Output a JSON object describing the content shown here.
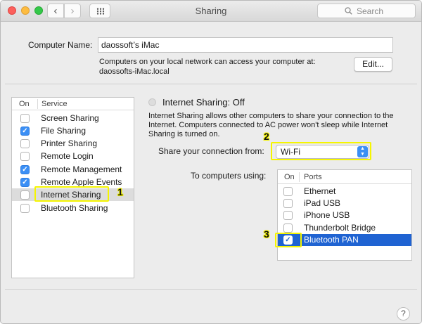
{
  "window": {
    "title": "Sharing",
    "search_placeholder": "Search",
    "back_glyph": "‹",
    "forward_glyph": "›"
  },
  "computer_name": {
    "label": "Computer Name:",
    "value": "daossoft’s iMac",
    "description_line1": "Computers on your local network can access your computer at:",
    "description_line2": "daossofts-iMac.local",
    "edit_label": "Edit..."
  },
  "services": {
    "col_on": "On",
    "col_service": "Service",
    "items": [
      {
        "label": "Screen Sharing",
        "checked": false
      },
      {
        "label": "File Sharing",
        "checked": true
      },
      {
        "label": "Printer Sharing",
        "checked": false
      },
      {
        "label": "Remote Login",
        "checked": false
      },
      {
        "label": "Remote Management",
        "checked": true
      },
      {
        "label": "Remote Apple Events",
        "checked": true
      },
      {
        "label": "Internet Sharing",
        "checked": false,
        "selected": true
      },
      {
        "label": "Bluetooth Sharing",
        "checked": false
      }
    ]
  },
  "internet_sharing": {
    "title": "Internet Sharing: Off",
    "description": "Internet Sharing allows other computers to share your connection to the Internet. Computers connected to AC power won't sleep while Internet Sharing is turned on.",
    "share_from_label": "Share your connection from:",
    "share_from_value": "Wi-Fi",
    "to_label": "To computers using:",
    "ports_col_on": "On",
    "ports_col_ports": "Ports",
    "ports": [
      {
        "label": "Ethernet",
        "checked": false
      },
      {
        "label": "iPad USB",
        "checked": false
      },
      {
        "label": "iPhone USB",
        "checked": false
      },
      {
        "label": "Thunderbolt Bridge",
        "checked": false
      },
      {
        "label": "Bluetooth PAN",
        "checked": true,
        "selected": true
      }
    ]
  },
  "annotations": {
    "step1": "1",
    "step2": "2",
    "step3": "3"
  },
  "help_label": "?",
  "colors": {
    "highlight": "#f5f500",
    "accent": "#3b8ff5",
    "selection": "#1f63d2"
  }
}
